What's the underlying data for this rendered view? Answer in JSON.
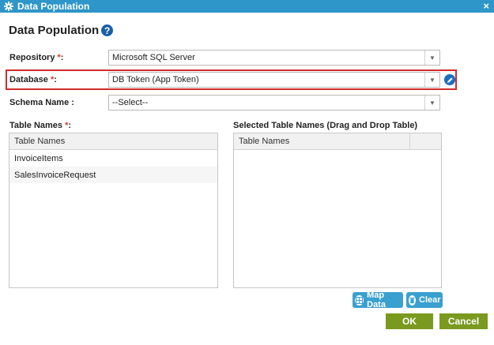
{
  "window": {
    "title": "Data Population",
    "close_glyph": "×"
  },
  "heading": {
    "title": "Data Population",
    "help_glyph": "?"
  },
  "form": {
    "repository": {
      "label": "Repository ",
      "required": "*",
      "colon": ":",
      "value": "Microsoft SQL Server"
    },
    "database": {
      "label": "Database ",
      "required": "*",
      "colon": ":",
      "value": "DB Token (App Token)"
    },
    "schema": {
      "label": "Schema Name :",
      "value": "--Select--"
    }
  },
  "tables": {
    "label": "Table Names ",
    "required": "*",
    "colon": ":",
    "header": "Table Names",
    "items": [
      "InvoiceItems",
      "SalesInvoiceRequest"
    ]
  },
  "selected": {
    "label": "Selected Table Names (Drag and Drop Table)",
    "header": "Table Names"
  },
  "buttons": {
    "map_data": "Map Data",
    "clear": "Clear",
    "ok": "OK",
    "cancel": "Cancel"
  },
  "icons": {
    "title": "gear-icon",
    "help": "help-icon",
    "edit": "pencil-icon",
    "map": "table-icon",
    "clear": "trash-icon"
  },
  "colors": {
    "titlebar": "#2e96c8",
    "primary_button": "#7a9a1f",
    "small_button": "#3aa0cf",
    "highlight": "#d12b2b"
  }
}
